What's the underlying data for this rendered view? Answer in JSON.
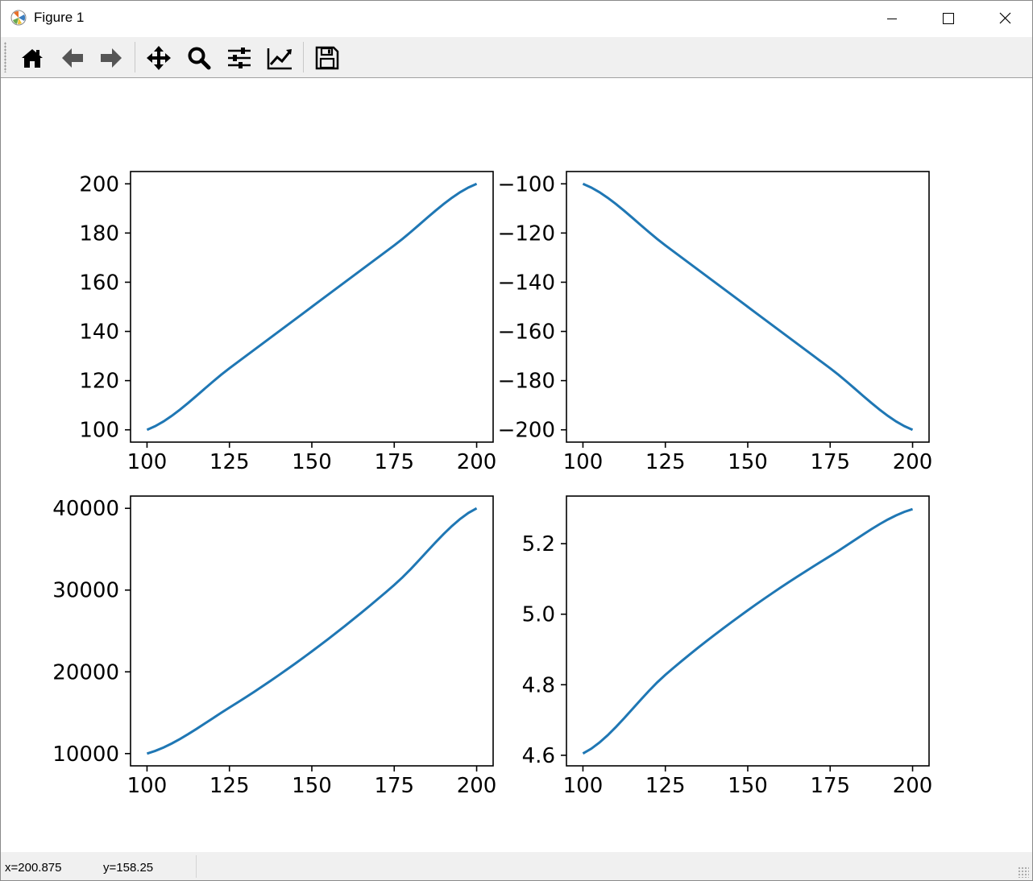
{
  "window": {
    "title": "Figure 1"
  },
  "toolbar": {
    "buttons": [
      {
        "name": "home-button",
        "icon": "home-icon"
      },
      {
        "name": "back-button",
        "icon": "arrow-left-icon"
      },
      {
        "name": "forward-button",
        "icon": "arrow-right-icon"
      },
      {
        "name": "pan-button",
        "icon": "move-icon"
      },
      {
        "name": "zoom-button",
        "icon": "magnifier-icon"
      },
      {
        "name": "subplots-button",
        "icon": "sliders-icon"
      },
      {
        "name": "edit-axis-button",
        "icon": "line-chart-icon"
      },
      {
        "name": "save-button",
        "icon": "floppy-disk-icon"
      }
    ]
  },
  "status": {
    "x": "x=200.875",
    "y": "y=158.25"
  },
  "colors": {
    "line": "#1f77b4",
    "toolbar_bg": "#f0f0f0"
  },
  "chart_data": [
    {
      "type": "line",
      "x": [
        100,
        125,
        150,
        175,
        200
      ],
      "series": [
        {
          "values": [
            100,
            125,
            150,
            175,
            200
          ]
        }
      ],
      "xlim": [
        95,
        205
      ],
      "ylim": [
        95,
        205
      ],
      "xticks": [
        "100",
        "125",
        "150",
        "175",
        "200"
      ],
      "yticks": [
        "100",
        "120",
        "140",
        "160",
        "180",
        "200"
      ]
    },
    {
      "type": "line",
      "x": [
        100,
        125,
        150,
        175,
        200
      ],
      "series": [
        {
          "values": [
            -100,
            -125,
            -150,
            -175,
            -200
          ]
        }
      ],
      "xlim": [
        95,
        205
      ],
      "ylim": [
        -205,
        -95
      ],
      "xticks": [
        "100",
        "125",
        "150",
        "175",
        "200"
      ],
      "yticks": [
        "−100",
        "−120",
        "−140",
        "−160",
        "−180",
        "−200"
      ]
    },
    {
      "type": "line",
      "x": [
        100,
        125,
        150,
        175,
        200
      ],
      "series": [
        {
          "values": [
            10000,
            15625,
            22500,
            30625,
            40000
          ]
        }
      ],
      "xlim": [
        95,
        205
      ],
      "ylim": [
        8500,
        41500
      ],
      "xticks": [
        "100",
        "125",
        "150",
        "175",
        "200"
      ],
      "yticks": [
        "10000",
        "20000",
        "30000",
        "40000"
      ]
    },
    {
      "type": "line",
      "x": [
        100,
        125,
        150,
        175,
        200
      ],
      "series": [
        {
          "values": [
            4.605,
            4.828,
            5.011,
            5.165,
            5.298
          ]
        }
      ],
      "xlim": [
        95,
        205
      ],
      "ylim": [
        4.57,
        5.335
      ],
      "xticks": [
        "100",
        "125",
        "150",
        "175",
        "200"
      ],
      "yticks": [
        "4.6",
        "4.8",
        "5.0",
        "5.2"
      ]
    }
  ]
}
